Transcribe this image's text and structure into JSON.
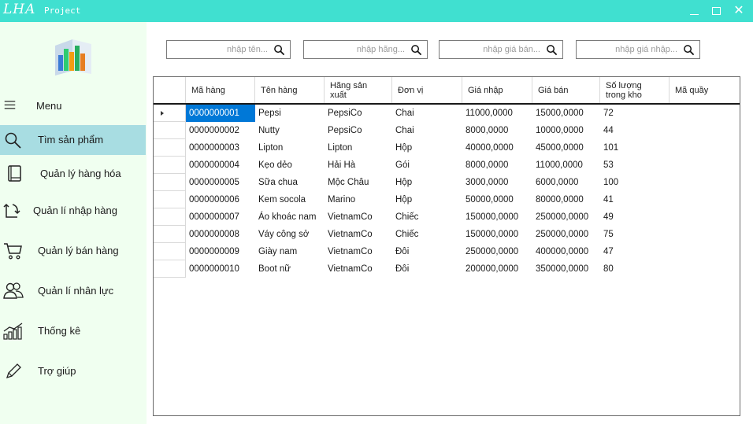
{
  "window": {
    "logo": "LHA",
    "project_label": "Project",
    "minimize_icon": "minimize-icon",
    "maximize_icon": "maximize-icon",
    "close_icon": "close-icon",
    "close_glyph": "✕"
  },
  "sidebar": {
    "items": [
      {
        "id": "menu",
        "label": "Menu",
        "icon": "hamburger-icon"
      },
      {
        "id": "tim-san-pham",
        "label": "Tìm sản phẩm",
        "icon": "search-icon",
        "active": true
      },
      {
        "id": "quan-ly-hang-hoa",
        "label": "Quản lý hàng hóa",
        "icon": "book-icon"
      },
      {
        "id": "quan-li-nhap-hang",
        "label": "Quản lí nhập hàng",
        "icon": "import-icon"
      },
      {
        "id": "quan-ly-ban-hang",
        "label": "Quản lý bán hàng",
        "icon": "cart-icon"
      },
      {
        "id": "quan-li-nhan-luc",
        "label": "Quản lí nhân lực",
        "icon": "users-icon"
      },
      {
        "id": "thong-ke",
        "label": "Thống kê",
        "icon": "chart-icon"
      },
      {
        "id": "tro-giup",
        "label": "Trợ giúp",
        "icon": "pencil-icon"
      }
    ]
  },
  "search": {
    "name_placeholder": "nhập tên...",
    "brand_placeholder": "nhập hãng...",
    "price_in_placeholder": "nhập giá bán...",
    "price_out_placeholder": "nhập giá nhập..."
  },
  "table": {
    "columns": [
      "Mã hàng",
      "Tên hàng",
      "Hãng sản xuất",
      "Đơn vị",
      "Giá nhập",
      "Giá bán",
      "Số lượng trong kho",
      "Mã quầy"
    ],
    "header_lines": {
      "hang_san_xuat": [
        "Hãng sản",
        "xuất"
      ],
      "so_luong": [
        "Số lượng",
        "trong kho"
      ]
    },
    "rows": [
      [
        "0000000001",
        "Pepsi",
        "PepsiCo",
        "Chai",
        "11000,0000",
        "15000,0000",
        "72",
        ""
      ],
      [
        "0000000002",
        "Nutty",
        "PepsiCo",
        "Chai",
        "8000,0000",
        "10000,0000",
        "44",
        ""
      ],
      [
        "0000000003",
        "Lipton",
        "Lipton",
        "Hộp",
        "40000,0000",
        "45000,0000",
        "101",
        ""
      ],
      [
        "0000000004",
        "Kẹo dẻo",
        "Hải Hà",
        "Gói",
        "8000,0000",
        "11000,0000",
        "53",
        ""
      ],
      [
        "0000000005",
        "Sữa chua",
        "Mộc Châu",
        "Hộp",
        "3000,0000",
        "6000,0000",
        "100",
        ""
      ],
      [
        "0000000006",
        "Kem socola",
        "Marino",
        "Hộp",
        "50000,0000",
        "80000,0000",
        "41",
        ""
      ],
      [
        "0000000007",
        "Áo khoác nam",
        "VietnamCo",
        "Chiếc",
        "150000,0000",
        "250000,0000",
        "49",
        ""
      ],
      [
        "0000000008",
        "Váy công sở",
        "VietnamCo",
        "Chiếc",
        "150000,0000",
        "250000,0000",
        "75",
        ""
      ],
      [
        "0000000009",
        "Giày nam",
        "VietnamCo",
        "Đôi",
        "250000,0000",
        "400000,0000",
        "47",
        ""
      ],
      [
        "0000000010",
        "Boot nữ",
        "VietnamCo",
        "Đôi",
        "200000,0000",
        "350000,0000",
        "80",
        ""
      ]
    ],
    "selected_row": 0
  },
  "colors": {
    "titlebar": "#40e0d0",
    "sidebar": "#f0fff0",
    "active_item": "#a8dde2",
    "selection": "#0078d7"
  }
}
